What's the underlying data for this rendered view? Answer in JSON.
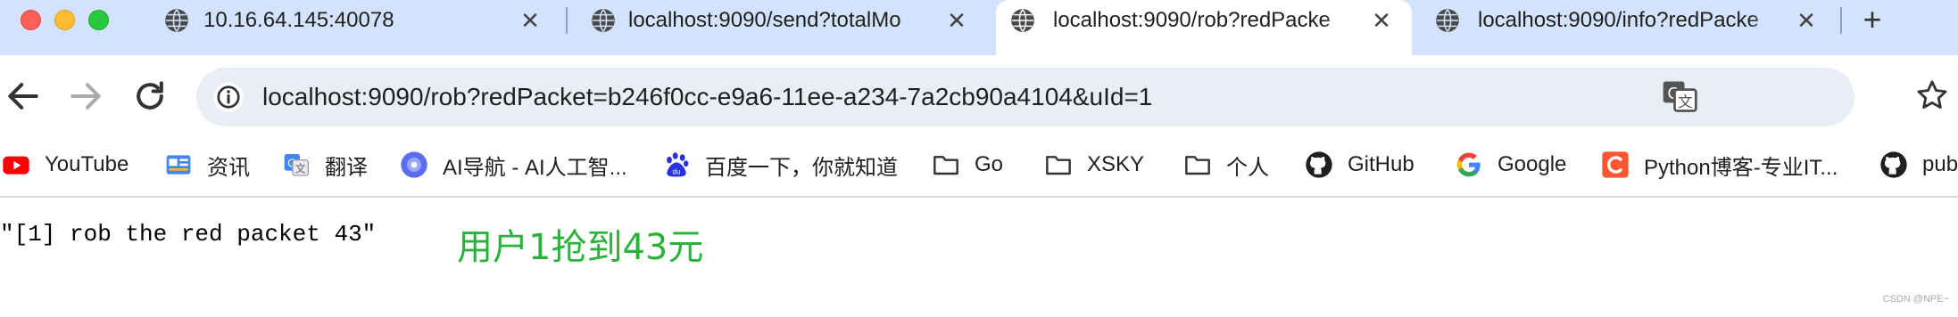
{
  "tabs": [
    {
      "title": "10.16.64.145:40078",
      "active": false
    },
    {
      "title": "localhost:9090/send?totalMo",
      "active": false
    },
    {
      "title": "localhost:9090/rob?redPacke",
      "active": true
    },
    {
      "title": "localhost:9090/info?redPacke",
      "active": false
    }
  ],
  "toolbar": {
    "url": "localhost:9090/rob?redPacket=b246f0cc-e9a6-11ee-a234-7a2cb90a4104&uId=1"
  },
  "bookmarks": [
    {
      "label": "YouTube",
      "icon": "youtube-icon"
    },
    {
      "label": "资讯",
      "icon": "news-icon"
    },
    {
      "label": "翻译",
      "icon": "translate-icon"
    },
    {
      "label": "AI导航 - AI人工智...",
      "icon": "ai-nav-icon"
    },
    {
      "label": "百度一下，你就知道",
      "icon": "baidu-icon"
    },
    {
      "label": "Go",
      "icon": "folder-icon"
    },
    {
      "label": "XSKY",
      "icon": "folder-icon"
    },
    {
      "label": "个人",
      "icon": "folder-icon"
    },
    {
      "label": "GitHub",
      "icon": "github-icon"
    },
    {
      "label": "Google",
      "icon": "google-icon"
    },
    {
      "label": "Python博客-专业IT...",
      "icon": "csdn-icon"
    },
    {
      "label": "pub",
      "icon": "github-icon"
    }
  ],
  "content": {
    "response": "\"[1] rob the red packet 43\"",
    "annotation": "用户1抢到43元",
    "annotation_color": "#28b33a",
    "watermark": "CSDN @NPE~"
  },
  "colors": {
    "tabstrip": "#d3e3fd",
    "omnibox": "#e9eef6"
  }
}
